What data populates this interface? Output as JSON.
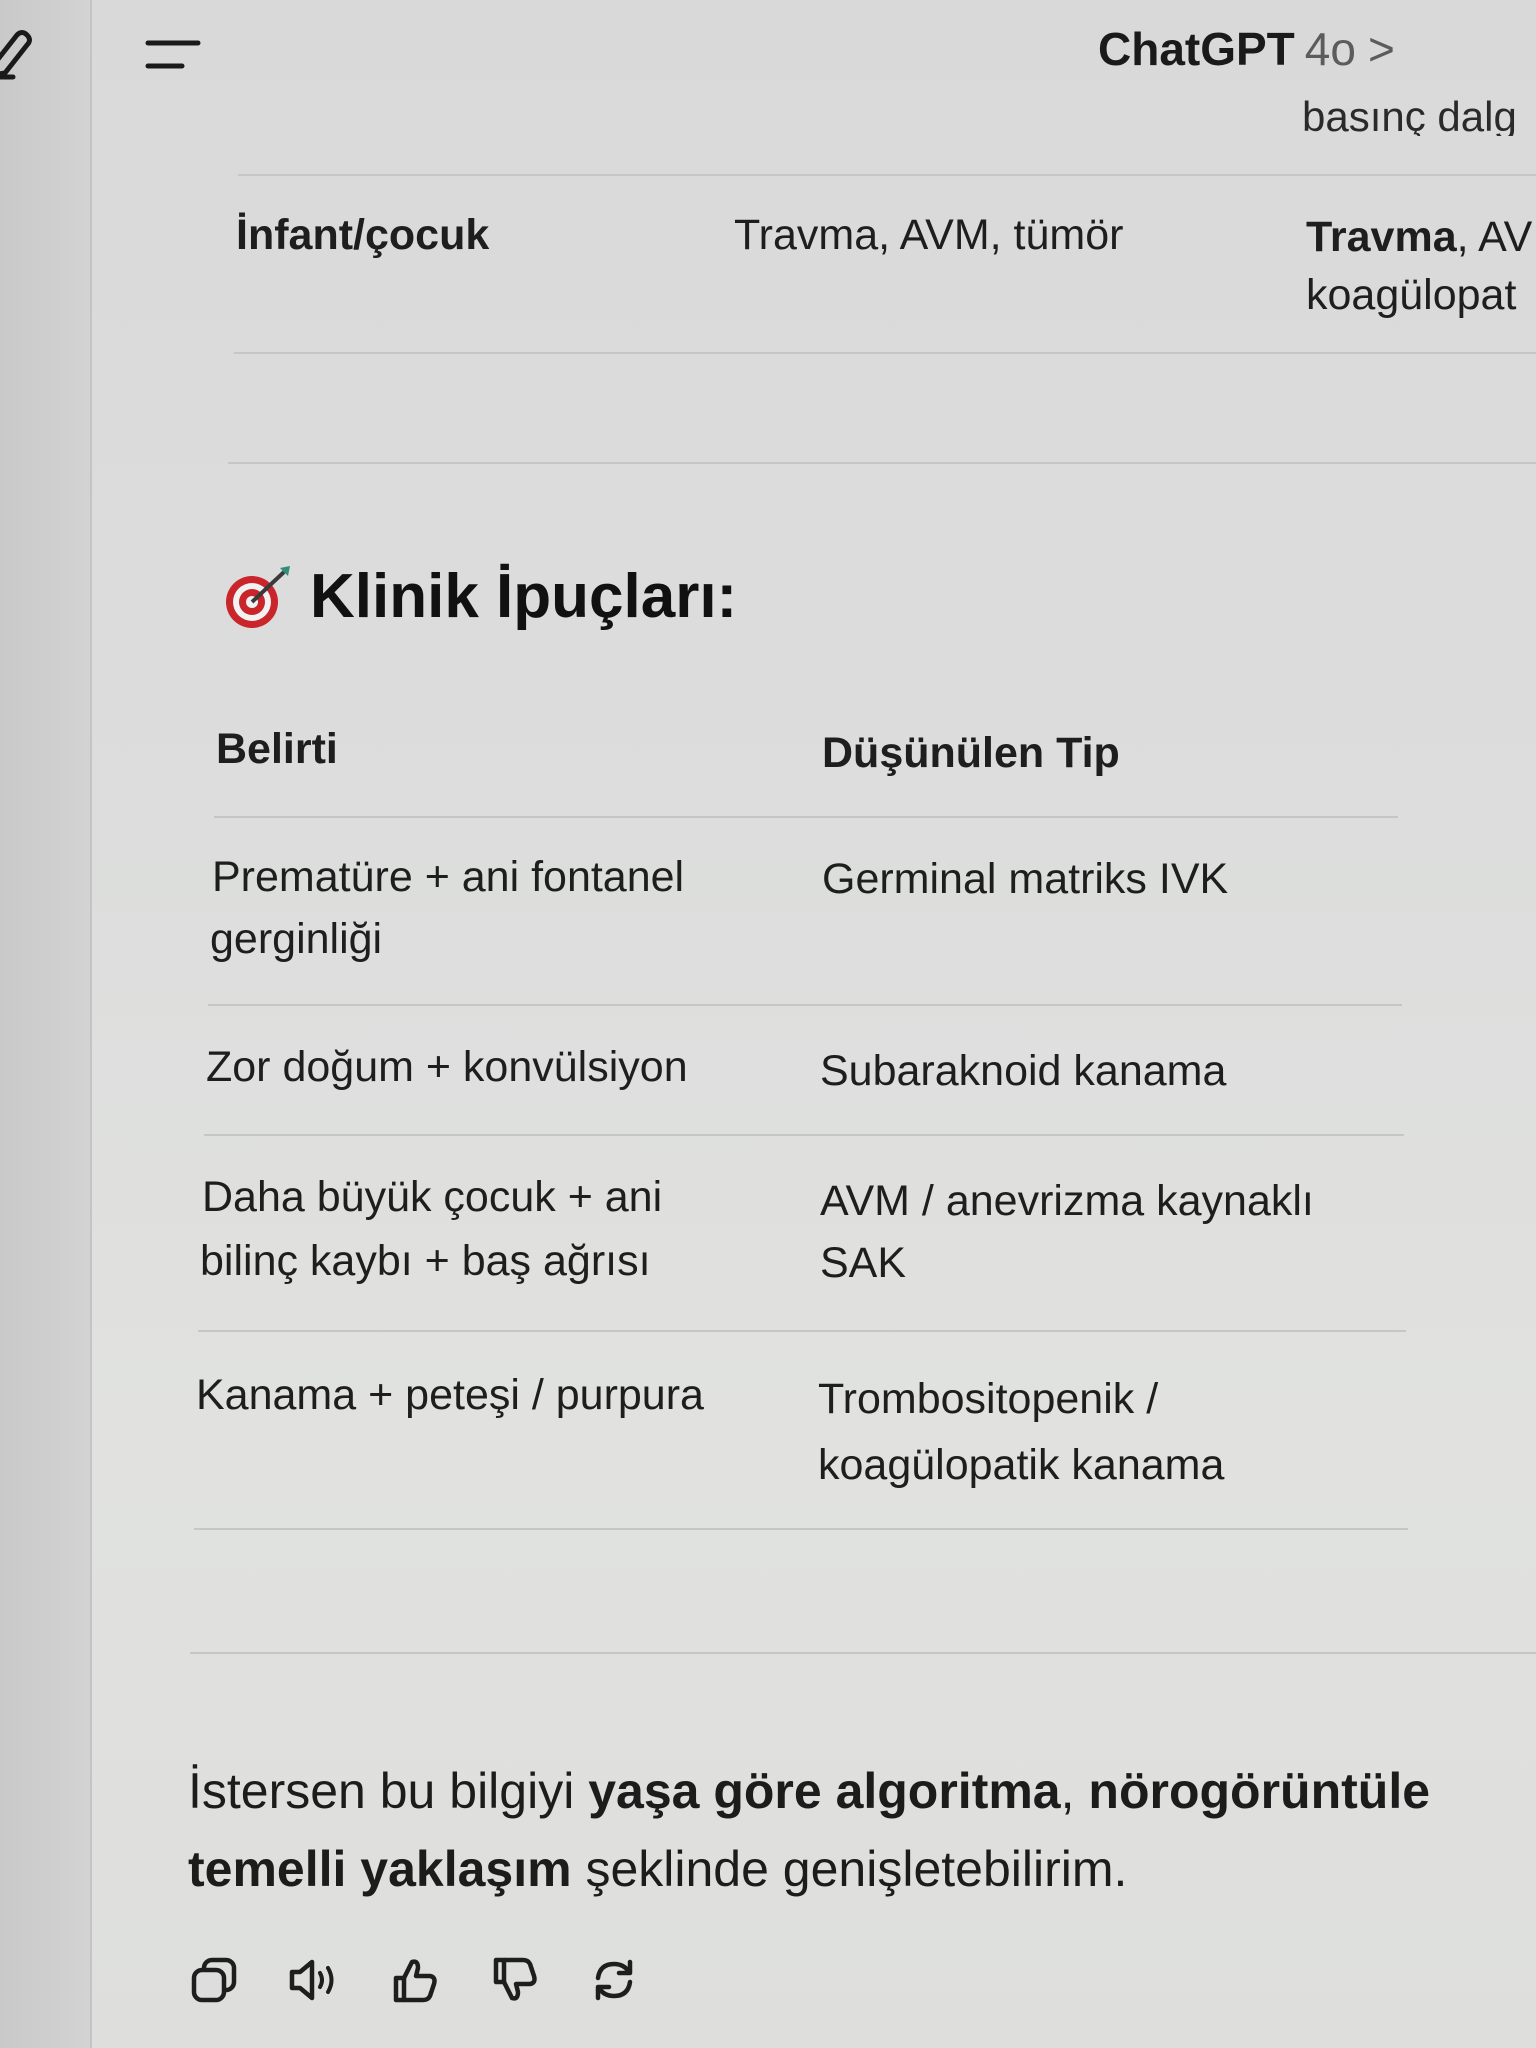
{
  "header": {
    "title": "ChatGPT",
    "model": "4o",
    "chevron": ">"
  },
  "icons": {
    "new_chat": "pencil-edit-icon",
    "menu": "hamburger-menu-icon",
    "section": "direct-hit-dart-icon"
  },
  "prev_table": {
    "cut_text": "basınç dalg",
    "row": {
      "col1": "İnfant/çocuk",
      "col2": "Travma, AVM, tümör",
      "col3_bold": "Travma",
      "col3_rest": ", AV",
      "col3_line2": "koagülopat"
    }
  },
  "section": {
    "emoji": "🎯",
    "title": "Klinik İpuçları:"
  },
  "table": {
    "headers": [
      "Belirti",
      "Düşünülen Tip"
    ],
    "rows": [
      {
        "symptom_lines": [
          "Prematüre + ani fontanel",
          "gerginliği"
        ],
        "type_lines": [
          "Germinal matriks IVK"
        ]
      },
      {
        "symptom_lines": [
          "Zor doğum + konvülsiyon"
        ],
        "type_lines": [
          "Subaraknoid kanama"
        ]
      },
      {
        "symptom_lines": [
          "Daha büyük çocuk + ani",
          "bilinç kaybı + baş ağrısı"
        ],
        "type_lines": [
          "AVM / anevrizma kaynaklı",
          "SAK"
        ]
      },
      {
        "symptom_lines": [
          "Kanama + peteşi / purpura"
        ],
        "type_lines": [
          "Trombositopenik /",
          "koagülopatik kanama"
        ]
      }
    ]
  },
  "closing": {
    "line1_a": "İstersen bu bilgiyi ",
    "line1_b": "yaşa göre algoritma",
    "line1_c": ", ",
    "line1_d": "nörogörüntüle",
    "line2_a": "temelli yaklaşım",
    "line2_b": " şeklinde genişletebilirim."
  },
  "actions": {
    "copy": "copy-icon",
    "read_aloud": "speaker-icon",
    "like": "thumbs-up-icon",
    "dislike": "thumbs-down-icon",
    "regenerate": "regenerate-icon"
  },
  "colors": {
    "background": "#dcdddc",
    "text": "#1c1c1c",
    "divider": "#c6c6c6",
    "muted": "#5c5c5c"
  }
}
